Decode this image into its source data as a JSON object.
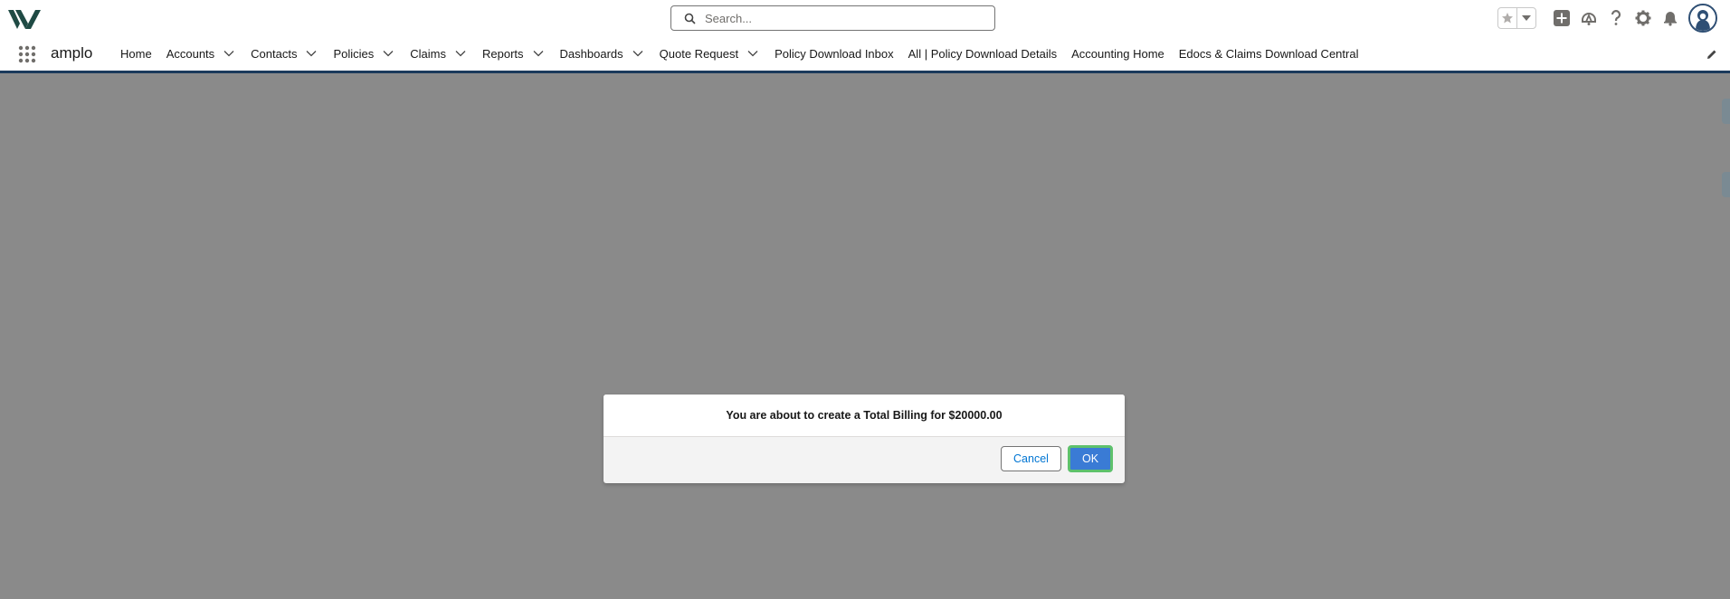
{
  "header": {
    "search_placeholder": "Search..."
  },
  "nav": {
    "app_name": "amplo",
    "items": [
      {
        "label": "Home",
        "dropdown": false
      },
      {
        "label": "Accounts",
        "dropdown": true
      },
      {
        "label": "Contacts",
        "dropdown": true
      },
      {
        "label": "Policies",
        "dropdown": true
      },
      {
        "label": "Claims",
        "dropdown": true
      },
      {
        "label": "Reports",
        "dropdown": true
      },
      {
        "label": "Dashboards",
        "dropdown": true
      },
      {
        "label": "Quote Request",
        "dropdown": true
      },
      {
        "label": "Policy Download Inbox",
        "dropdown": false
      },
      {
        "label": "All | Policy Download Details",
        "dropdown": false
      },
      {
        "label": "Accounting Home",
        "dropdown": false
      },
      {
        "label": "Edocs & Claims Download Central",
        "dropdown": false
      }
    ]
  },
  "dialog": {
    "message": "You are about to create a Total Billing for $20000.00",
    "cancel_label": "Cancel",
    "ok_label": "OK"
  },
  "colors": {
    "overlay": "#8a8a8a",
    "brand_dark": "#1b3a5c",
    "ok_button": "#3a7bd5",
    "focus_ring": "#5ec16c",
    "link": "#0176d3"
  }
}
